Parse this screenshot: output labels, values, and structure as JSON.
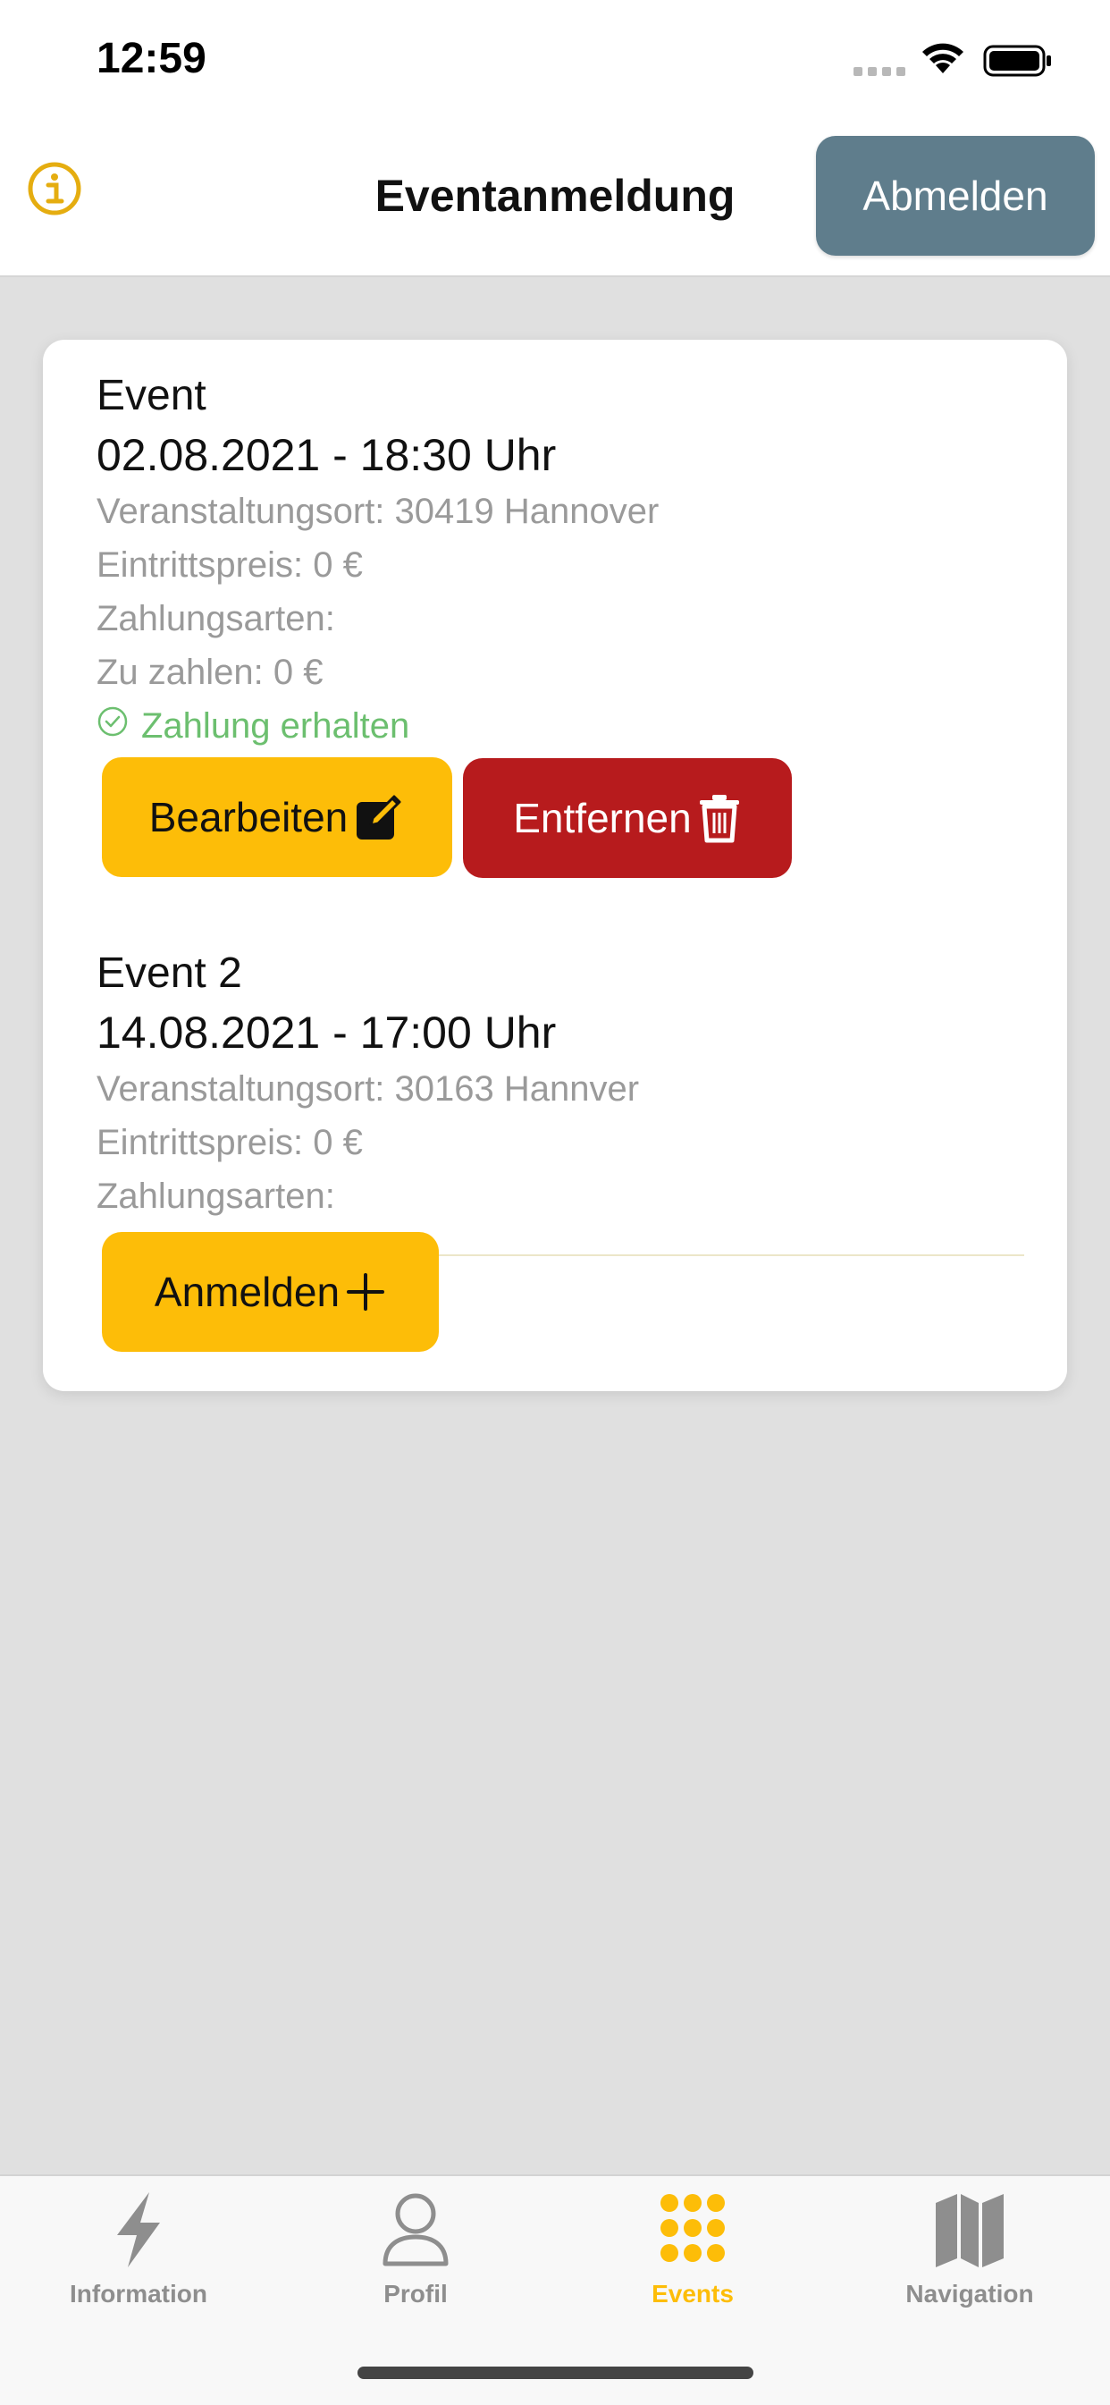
{
  "status_bar": {
    "time": "12:59"
  },
  "header": {
    "title": "Eventanmeldung",
    "logout_label": "Abmelden"
  },
  "events": [
    {
      "name": "Event",
      "date": "02.08.2021 - 18:30 Uhr",
      "location": "Veranstaltungsort: 30419 Hannover",
      "price": "Eintrittspreis: 0 €",
      "payment_methods": "Zahlungsarten:",
      "amount_due": "Zu zahlen: 0 €",
      "payment_status": "Zahlung erhalten",
      "edit_label": "Bearbeiten",
      "remove_label": "Entfernen"
    },
    {
      "name": "Event 2",
      "date": "14.08.2021 - 17:00 Uhr",
      "location": "Veranstaltungsort: 30163 Hannver",
      "price": "Eintrittspreis: 0 €",
      "payment_methods": "Zahlungsarten:",
      "register_label": "Anmelden"
    }
  ],
  "tabs": [
    {
      "label": "Information",
      "icon": "bolt-icon"
    },
    {
      "label": "Profil",
      "icon": "person-icon"
    },
    {
      "label": "Events",
      "icon": "grid-dots-icon"
    },
    {
      "label": "Navigation",
      "icon": "map-icon"
    }
  ],
  "active_tab": "Events",
  "colors": {
    "accent_yellow": "#fdbd08",
    "danger_red": "#b71b1d",
    "logout_gray": "#5f7d8c",
    "success_green": "#6cbf6f",
    "background": "#e0e0e0"
  }
}
